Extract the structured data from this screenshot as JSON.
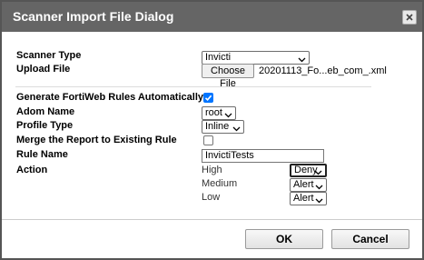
{
  "dialog": {
    "title": "Scanner Import File Dialog"
  },
  "icons": {
    "close": "close-icon",
    "dropdown": "chevron-down-icon",
    "check": "checkmark-icon"
  },
  "form": {
    "scanner_type": {
      "label": "Scanner Type",
      "value": "Invicti"
    },
    "upload_file": {
      "label": "Upload File",
      "button_label": "Choose File",
      "file_name": "20201113_Fo...eb_com_.xml"
    },
    "generate_rules": {
      "label": "Generate FortiWeb Rules Automatically",
      "checked": true
    },
    "adom_name": {
      "label": "Adom Name",
      "value": "root"
    },
    "profile_type": {
      "label": "Profile Type",
      "value": "Inline"
    },
    "merge_report": {
      "label": "Merge the Report to Existing Rule",
      "checked": false
    },
    "rule_name": {
      "label": "Rule Name",
      "value": "InvictiTests"
    },
    "action": {
      "label": "Action",
      "levels": [
        {
          "label": "High",
          "value": "Deny"
        },
        {
          "label": "Medium",
          "value": "Alert"
        },
        {
          "label": "Low",
          "value": "Alert"
        }
      ]
    }
  },
  "footer": {
    "ok_label": "OK",
    "cancel_label": "Cancel"
  },
  "colors": {
    "titlebar": "#656565",
    "checkbox_accent": "#0075ff"
  }
}
